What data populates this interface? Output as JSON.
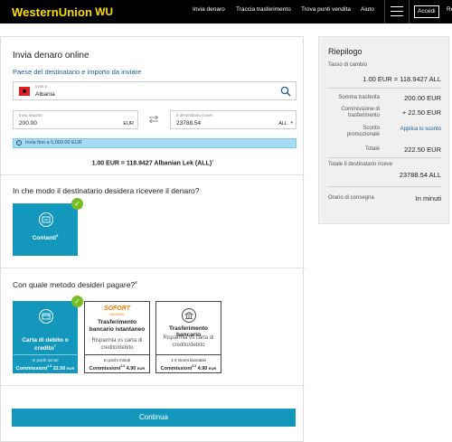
{
  "brand": {
    "logo_text": "WesternUnion",
    "logo_mark": "WU",
    "logo_color": "#ffdd00"
  },
  "nav": {
    "items": [
      "Invia denaro",
      "Traccia trasferimento",
      "Trova punti vendita",
      "Aiuto"
    ],
    "login_label": "Accedi",
    "cut_label": "Re",
    "menu_icon": "hamburger-icon"
  },
  "form": {
    "title": "Invia denaro online",
    "destination_section_label": "Paese del destinatario e importo da inviare",
    "country_caption": "Invia a",
    "country_value": "Albania",
    "amount_caption": "Invia importo",
    "amount_value": "200.00",
    "amount_currency": "EUR",
    "receive_caption": "Il destinatario riceve",
    "receive_value": "23788.54",
    "receive_currency": "ALL",
    "limit_info": "Invia fino a 5,000.00 EUR",
    "rate_text": "1.00 EUR = 118.9427 Albanian Lek (ALL)",
    "rate_sup": "1",
    "receive_question": "In che modo il destinatario desidera ricevere il denaro?",
    "receive_options": [
      {
        "label": "Contanti",
        "sup": "8",
        "selected": true
      }
    ],
    "pay_question": "Con quale metodo desideri pagare?",
    "pay_question_sup": "8",
    "pay_options": [
      {
        "title": "Carta di debito o credito",
        "title_sup": "7",
        "subtitle": "",
        "speed": "In pochi minuti",
        "fee_label": "Commissioni",
        "fee_sup": "2,3",
        "fee": "22.50",
        "fee_currency": "EUR",
        "selected": true
      },
      {
        "brand": "SOFORT",
        "brand_sub": "BANKING",
        "title": "Trasferimento bancario istantaneo",
        "subtitle": "Risparmia vs carta di credito/debito",
        "speed": "In pochi minuti",
        "fee_label": "Commissioni",
        "fee_sup": "2,3",
        "fee": "4.90",
        "fee_currency": "EUR",
        "selected": false
      },
      {
        "title": "Trasferimento bancario",
        "subtitle": "Risparmia vs carta di credito/debito",
        "speed": "1-2 Giorni lavorativi",
        "fee_label": "Commissioni",
        "fee_sup": "2,3",
        "fee": "4.90",
        "fee_currency": "EUR",
        "selected": false
      }
    ],
    "continue_label": "Continua"
  },
  "summary": {
    "title": "Riepilogo",
    "exchange_caption": "Tasso di cambio",
    "exchange_value": "1.00 EUR = 118.9427 ALL",
    "transfer_amount_caption": "Somma trasferita",
    "transfer_amount_value": "200.00 EUR",
    "fee_caption": "Commissione di trasferimento",
    "fee_value": "+ 22.50 EUR",
    "promo_caption": "Sconto promozionale",
    "promo_link": "Applica lo sconto",
    "total_caption": "Totale",
    "total_value": "222.50 EUR",
    "receiver_total_caption": "Totale Il destinatario riceve",
    "receiver_total_value": "23788.54 ALL",
    "delivery_caption": "Orario di consegna",
    "delivery_value": "In minuti"
  },
  "colors": {
    "accent": "#1497bd",
    "success": "#76bd22",
    "info_bg": "#a8dcf2",
    "link": "#1a5f91"
  }
}
